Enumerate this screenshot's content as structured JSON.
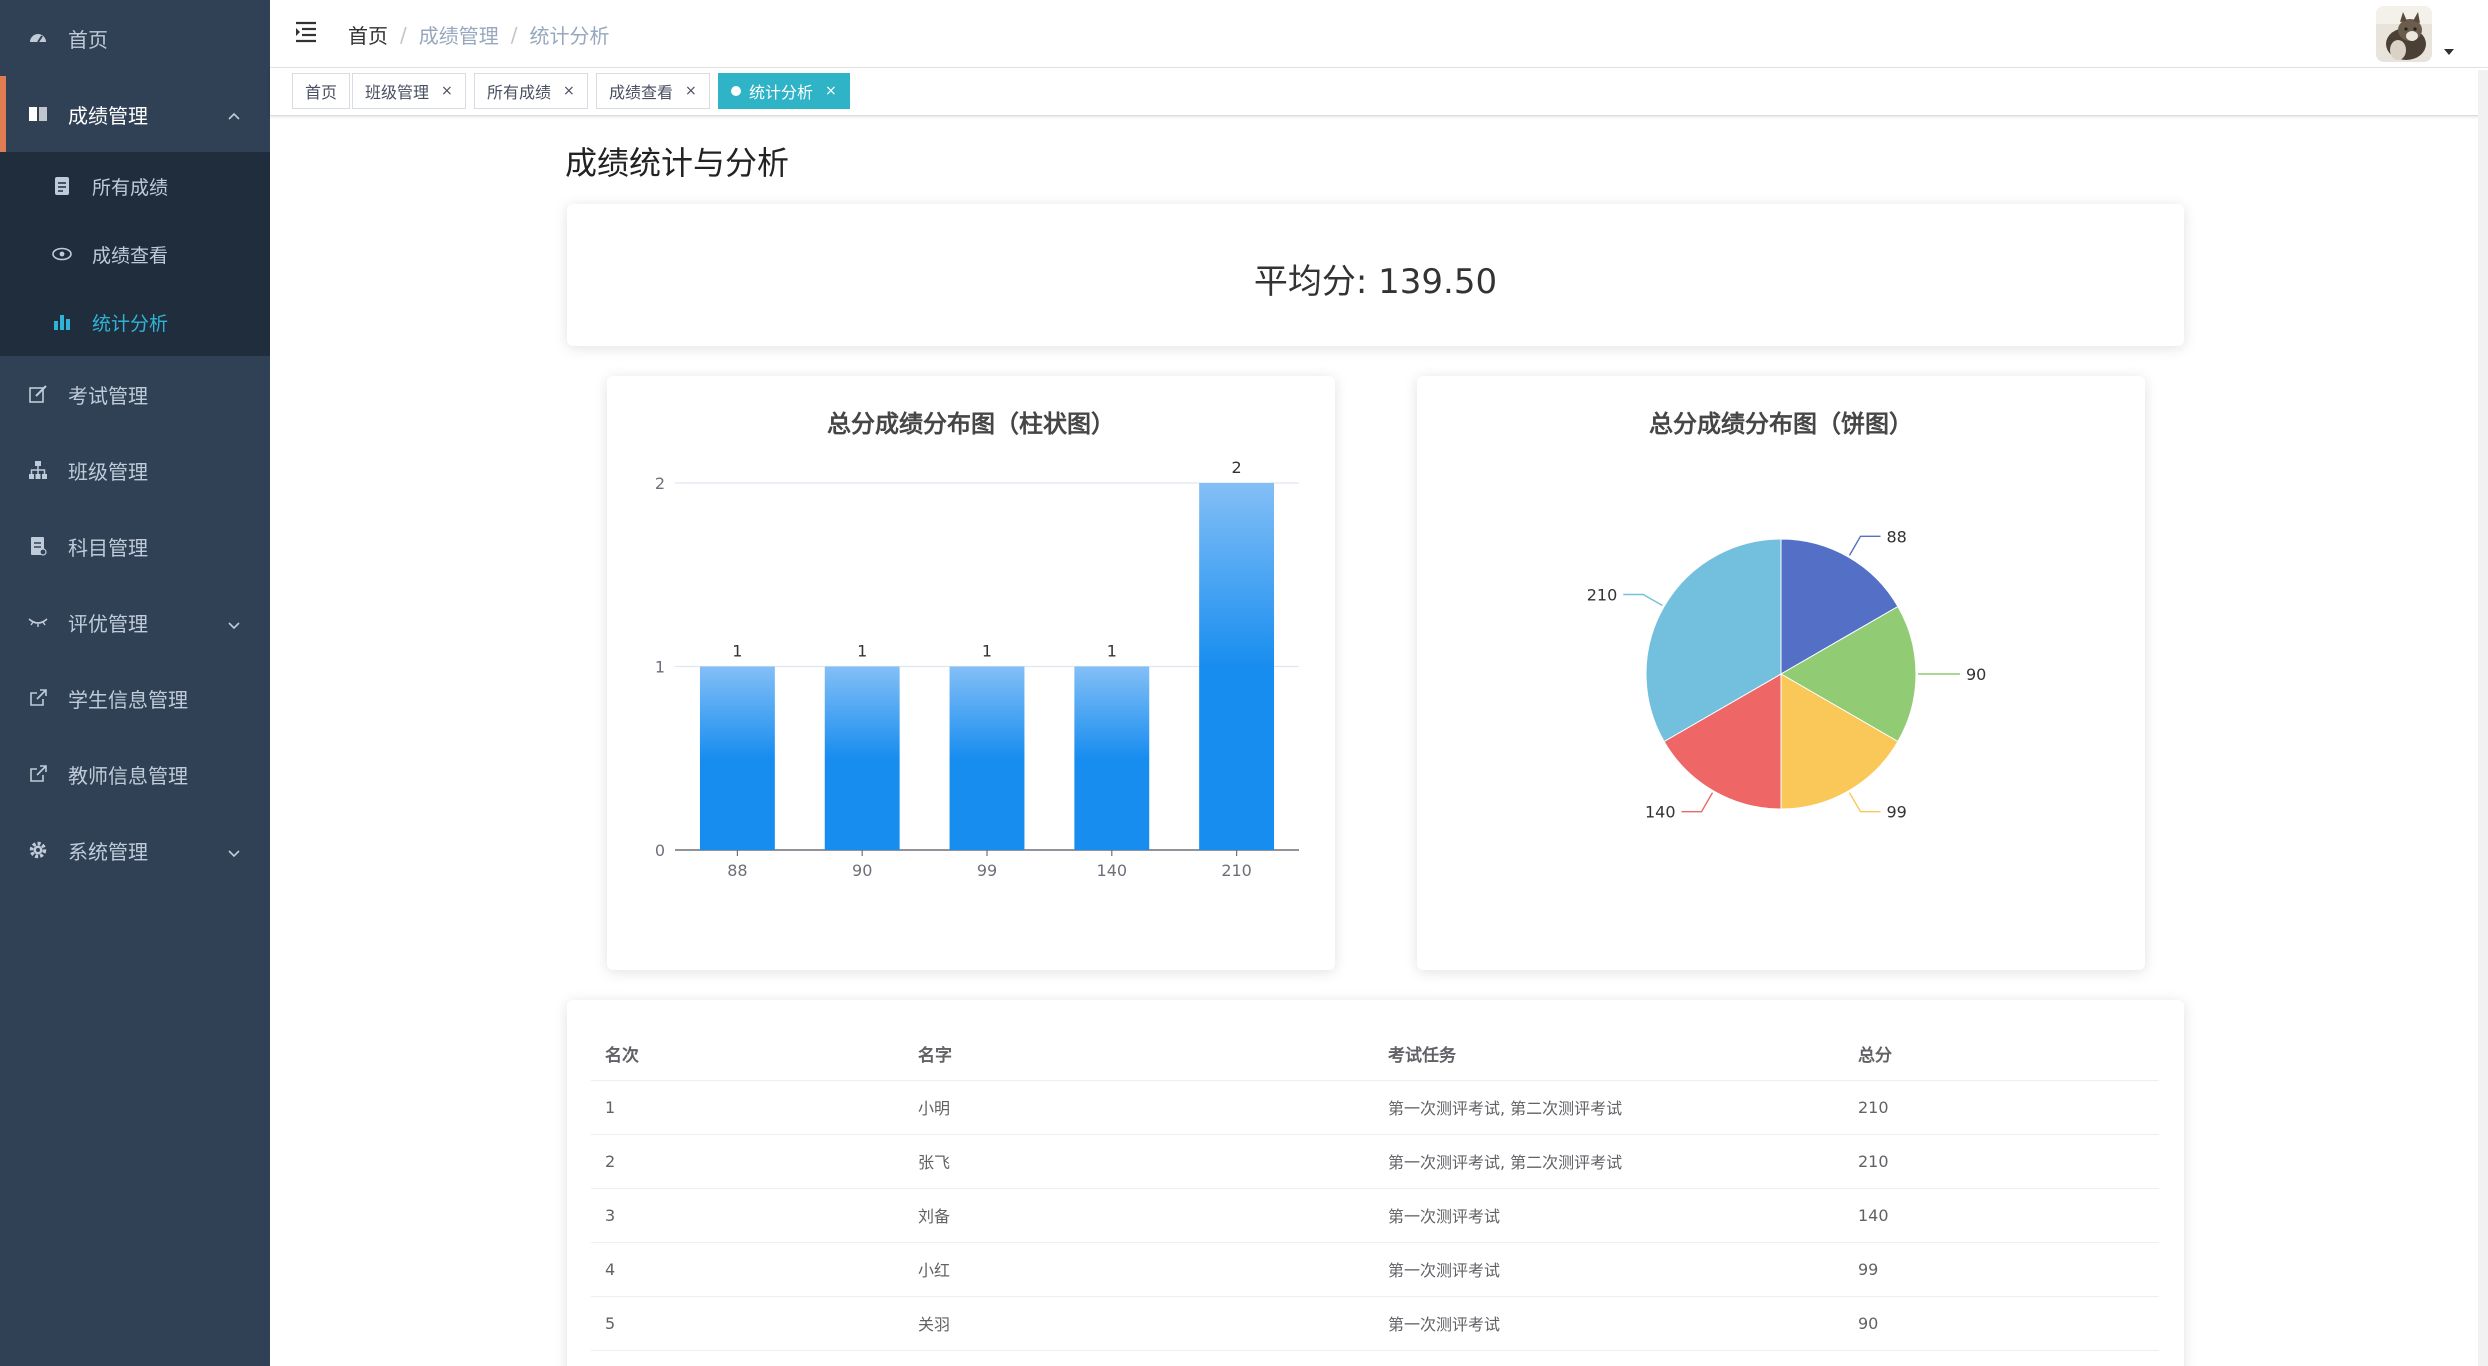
{
  "sidebar": {
    "items": [
      {
        "label": "首页",
        "icon": "dashboard-icon"
      },
      {
        "label": "成绩管理",
        "icon": "book-icon",
        "open": true
      },
      {
        "label": "考试管理",
        "icon": "edit-icon"
      },
      {
        "label": "班级管理",
        "icon": "tree-icon"
      },
      {
        "label": "科目管理",
        "icon": "document-icon"
      },
      {
        "label": "评优管理",
        "icon": "eye-closed-icon"
      },
      {
        "label": "学生信息管理",
        "icon": "external-link-icon"
      },
      {
        "label": "教师信息管理",
        "icon": "external-link-icon"
      },
      {
        "label": "系统管理",
        "icon": "gear-icon"
      }
    ],
    "submenu": [
      {
        "label": "所有成绩",
        "icon": "file-icon"
      },
      {
        "label": "成绩查看",
        "icon": "eye-icon"
      },
      {
        "label": "统计分析",
        "icon": "bar-chart-icon",
        "active": true
      }
    ],
    "active_color": "#2fb3d6"
  },
  "header": {
    "breadcrumb": [
      "首页",
      "成绩管理",
      "统计分析"
    ]
  },
  "tags": [
    {
      "label": "首页",
      "closable": false
    },
    {
      "label": "班级管理",
      "closable": true
    },
    {
      "label": "所有成绩",
      "closable": true
    },
    {
      "label": "成绩查看",
      "closable": true
    },
    {
      "label": "统计分析",
      "closable": true,
      "active": true
    }
  ],
  "main": {
    "title": "成绩统计与分析",
    "average_label": "平均分: 139.50"
  },
  "chart_data": [
    {
      "type": "bar",
      "title": "总分成绩分布图（柱状图）",
      "categories": [
        "88",
        "90",
        "99",
        "140",
        "210"
      ],
      "values": [
        1,
        1,
        1,
        1,
        2
      ],
      "ylim": [
        0,
        2
      ],
      "yticks": [
        "0",
        "1",
        "2"
      ],
      "grid": true,
      "colors": [
        "#1a8be8",
        "#83bff6"
      ]
    },
    {
      "type": "pie",
      "title": "总分成绩分布图（饼图）",
      "categories": [
        "88",
        "90",
        "99",
        "140",
        "210"
      ],
      "values": [
        1,
        1,
        1,
        1,
        2
      ],
      "colors": [
        "#5470c6",
        "#91cc75",
        "#fac858",
        "#ee6666",
        "#73c0de"
      ]
    }
  ],
  "table": {
    "headers": [
      "名次",
      "名字",
      "考试任务",
      "总分"
    ],
    "rows": [
      [
        "1",
        "小明",
        "第一次测评考试, 第二次测评考试",
        "210"
      ],
      [
        "2",
        "张飞",
        "第一次测评考试, 第二次测评考试",
        "210"
      ],
      [
        "3",
        "刘备",
        "第一次测评考试",
        "140"
      ],
      [
        "4",
        "小红",
        "第一次测评考试",
        "99"
      ],
      [
        "5",
        "关羽",
        "第一次测评考试",
        "90"
      ]
    ]
  }
}
